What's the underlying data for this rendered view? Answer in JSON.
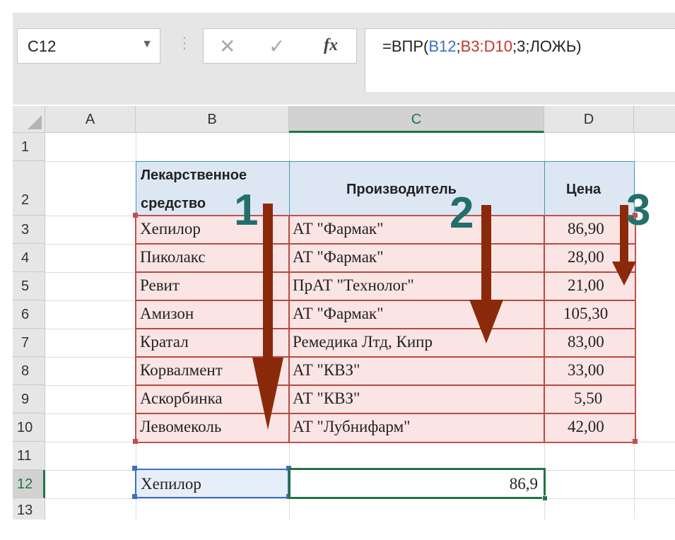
{
  "formula_bar": {
    "name_box": "C12",
    "name_box_arrow": "▼",
    "separator": "⋮",
    "cancel_glyph": "✕",
    "enter_glyph": "✓",
    "fx_glyph": "fx",
    "formula_prefix": "=ВПР(",
    "formula_ref1": "B12",
    "formula_sep1": ";",
    "formula_ref2": "B3:D10",
    "formula_suffix": ";3;ЛОЖЬ)"
  },
  "columns": [
    "A",
    "B",
    "C",
    "D"
  ],
  "rows": [
    "1",
    "2",
    "3",
    "4",
    "5",
    "6",
    "7",
    "8",
    "9",
    "10",
    "11",
    "12",
    "13"
  ],
  "table": {
    "headers": {
      "b_line1": "Лекарственное",
      "b_line2": "средство",
      "c": "Производитель",
      "d": "Цена"
    },
    "data": [
      {
        "name": "Хепилор",
        "maker": "АТ \"Фармак\"",
        "price": "86,90"
      },
      {
        "name": "Пиколакс",
        "maker": "АТ \"Фармак\"",
        "price": "28,00"
      },
      {
        "name": "Ревит",
        "maker": "ПрАТ \"Технолог\"",
        "price": "21,00"
      },
      {
        "name": "Амизон",
        "maker": "АТ \"Фармак\"",
        "price": "105,30"
      },
      {
        "name": "Кратал",
        "maker": "Ремедика Лтд, Кипр",
        "price": "83,00"
      },
      {
        "name": "Корвалмент",
        "maker": "АТ \"КВЗ\"",
        "price": "33,00"
      },
      {
        "name": "Аскорбинка",
        "maker": "АТ \"КВЗ\"",
        "price": "5,50"
      },
      {
        "name": "Левомеколь",
        "maker": "АТ \"Лубнифарм\"",
        "price": "42,00"
      }
    ]
  },
  "lookup": {
    "input": "Хепилор",
    "result": "86,9"
  },
  "annotations": {
    "label1": "1",
    "label2": "2",
    "label3": "3"
  },
  "colors": {
    "accent_green": "#217346",
    "arrow_brown": "#8b2a0a",
    "number_teal": "#22706b",
    "range_red": "#b74a3e",
    "ref_blue": "#3b6fc4"
  }
}
